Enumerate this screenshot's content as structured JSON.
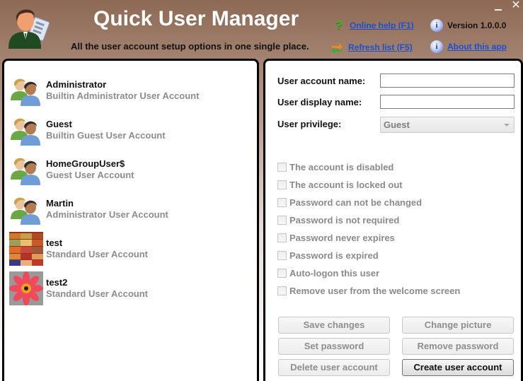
{
  "header": {
    "title": "Quick User Manager",
    "subtitle": "All the user account setup options in one single place.",
    "links": {
      "online_help": "Online help (F1)",
      "refresh_list": "Refresh list (F5)",
      "version": "Version 1.0.0.0",
      "about": "About this app"
    },
    "icons": {
      "logo": "businessman-checklist-icon",
      "help": "question-mark-icon",
      "refresh": "refresh-arrows-icon",
      "info": "info-icon"
    },
    "window_controls": {
      "minimize": "minimize",
      "close": "✕"
    }
  },
  "users": [
    {
      "name": "Administrator",
      "description": "Builtin Administrator User Account",
      "avatar": "users-group"
    },
    {
      "name": "Guest",
      "description": "Builtin Guest User Account",
      "avatar": "users-group"
    },
    {
      "name": "HomeGroupUser$",
      "description": "Guest User Account",
      "avatar": "users-group"
    },
    {
      "name": "Martin",
      "description": "Administrator User Account",
      "avatar": "users-group"
    },
    {
      "name": "test",
      "description": "Standard User Account",
      "avatar": "fabric-photo"
    },
    {
      "name": "test2",
      "description": "Standard User Account",
      "avatar": "flower-photo"
    }
  ],
  "form": {
    "account_name_label": "User account name:",
    "account_name_value": "",
    "display_name_label": "User display name:",
    "display_name_value": "",
    "privilege_label": "User privilege:",
    "privilege_value": "Guest"
  },
  "options": [
    {
      "label": "The account is disabled",
      "checked": false
    },
    {
      "label": "The account is locked out",
      "checked": false
    },
    {
      "label": "Password can not be changed",
      "checked": false
    },
    {
      "label": "Password is not required",
      "checked": false
    },
    {
      "label": "Password never expires",
      "checked": false
    },
    {
      "label": "Password is expired",
      "checked": false
    },
    {
      "label": "Auto-logon this user",
      "checked": false
    },
    {
      "label": "Remove user from the welcome screen",
      "checked": false
    }
  ],
  "buttons": {
    "save_changes": "Save changes",
    "change_picture": "Change picture",
    "set_password": "Set password",
    "remove_password": "Remove password",
    "delete_user": "Delete user account",
    "create_user": "Create user account"
  },
  "colors": {
    "header_top": "#8d6a55",
    "link": "#1a4fd0",
    "panel_border": "#000000",
    "disabled_text": "#8c8c8c"
  }
}
